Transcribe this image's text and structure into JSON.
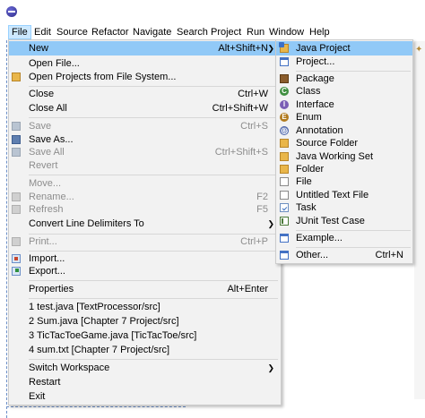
{
  "menubar": {
    "items": [
      "File",
      "Edit",
      "Source",
      "Refactor",
      "Navigate",
      "Search",
      "Project",
      "Run",
      "Window",
      "Help"
    ]
  },
  "file_menu": {
    "new": {
      "label": "New",
      "shortcut": "Alt+Shift+N"
    },
    "open_file": {
      "label": "Open File..."
    },
    "open_projects": {
      "label": "Open Projects from File System..."
    },
    "close": {
      "label": "Close",
      "shortcut": "Ctrl+W"
    },
    "close_all": {
      "label": "Close All",
      "shortcut": "Ctrl+Shift+W"
    },
    "save": {
      "label": "Save",
      "shortcut": "Ctrl+S"
    },
    "save_as": {
      "label": "Save As..."
    },
    "save_all": {
      "label": "Save All",
      "shortcut": "Ctrl+Shift+S"
    },
    "revert": {
      "label": "Revert"
    },
    "move": {
      "label": "Move..."
    },
    "rename": {
      "label": "Rename...",
      "shortcut": "F2"
    },
    "refresh": {
      "label": "Refresh",
      "shortcut": "F5"
    },
    "convert": {
      "label": "Convert Line Delimiters To"
    },
    "print": {
      "label": "Print...",
      "shortcut": "Ctrl+P"
    },
    "import": {
      "label": "Import..."
    },
    "export": {
      "label": "Export..."
    },
    "properties": {
      "label": "Properties",
      "shortcut": "Alt+Enter"
    },
    "recent": [
      "1 test.java  [TextProcessor/src]",
      "2 Sum.java  [Chapter 7 Project/src]",
      "3 TicTacToeGame.java  [TicTacToe/src]",
      "4 sum.txt  [Chapter 7 Project/src]"
    ],
    "switch_workspace": {
      "label": "Switch Workspace"
    },
    "restart": {
      "label": "Restart"
    },
    "exit": {
      "label": "Exit"
    }
  },
  "new_submenu": {
    "java_project": "Java Project",
    "project": "Project...",
    "package": "Package",
    "class": "Class",
    "interface": "Interface",
    "enum": "Enum",
    "annotation": "Annotation",
    "source_folder": "Source Folder",
    "java_working_set": "Java Working Set",
    "folder": "Folder",
    "file": "File",
    "untitled_text_file": "Untitled Text File",
    "task": "Task",
    "junit_test_case": "JUnit Test Case",
    "example": "Example...",
    "other": {
      "label": "Other...",
      "shortcut": "Ctrl+N"
    }
  },
  "colors": {
    "menu_bg": "#f2f2f2",
    "highlight": "#91c9f7",
    "disabled_text": "#8d8d8d",
    "menubar_active": "#cce8ff"
  }
}
